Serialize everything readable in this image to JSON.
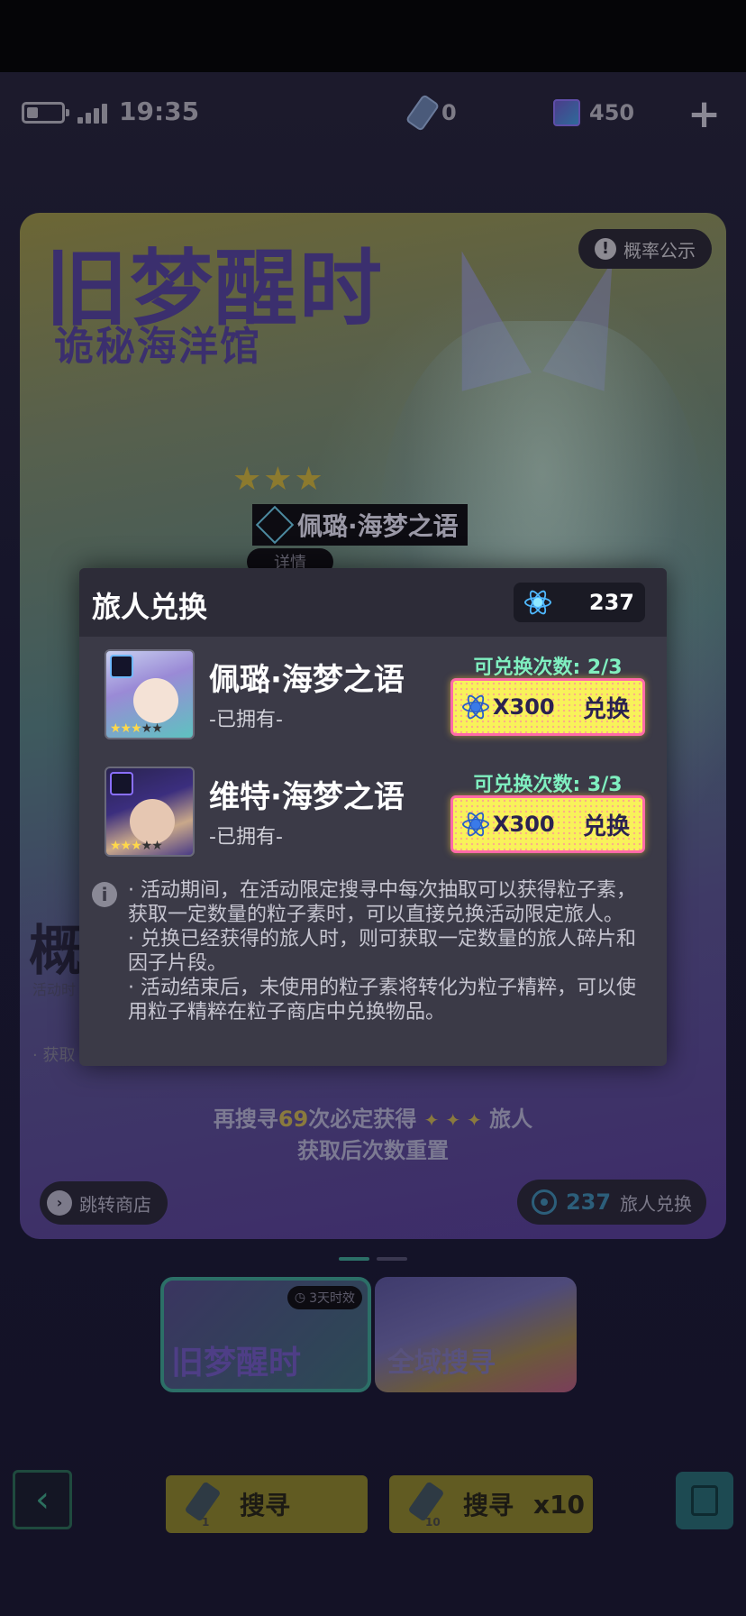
{
  "status_bar": {
    "time": "19:35",
    "ticket_count": "0",
    "cube_count": "450",
    "plus_label": "+"
  },
  "banner": {
    "title": "旧梦醒时",
    "subtitle": "诡秘海洋馆",
    "probability_label": "概率公示",
    "stars": "★★★",
    "featured_name": "佩璐·海梦之语",
    "detail_label": "详情",
    "guarantee_line1_prefix": "再搜寻",
    "guarantee_number": "69",
    "guarantee_line1_mid": "次必定获得",
    "guarantee_stars": "✦ ✦ ✦",
    "guarantee_line1_suffix": "旅人",
    "guarantee_line2": "获取后次数重置",
    "shop_label": "跳转商店",
    "exchange_count": "237",
    "exchange_label": "旅人兑换",
    "left_big": "概",
    "left_small": "活动时",
    "left_dot": "· 获取"
  },
  "tabs": [
    {
      "name": "旧梦醒时",
      "timer": "3天时效"
    },
    {
      "name": "全域搜寻"
    }
  ],
  "bottom_bar": {
    "back_icon": "‹",
    "search_single_label": "搜寻",
    "search_single_count": "1",
    "search_multi_label": "搜寻",
    "search_multi_suffix": "x10",
    "search_multi_count": "10"
  },
  "modal": {
    "title": "旅人兑换",
    "balance": "237",
    "items": [
      {
        "name": "佩璐·海梦之语",
        "owned": "-已拥有-",
        "count_label": "可兑换次数:  2/3",
        "price": "X300",
        "button": "兑换"
      },
      {
        "name": "维特·海梦之语",
        "owned": "-已拥有-",
        "count_label": "可兑换次数:  3/3",
        "price": "X300",
        "button": "兑换"
      }
    ],
    "info_icon": "i",
    "notes": [
      "· 活动期间，在活动限定搜寻中每次抽取可以获得粒子素，获取一定数量的粒子素时，可以直接兑换活动限定旅人。",
      "· 兑换已经获得的旅人时，则可获取一定数量的旅人碎片和因子片段。",
      "· 活动结束后，未使用的粒子素将转化为粒子精粹，可以使用粒子精粹在粒子商店中兑换物品。"
    ]
  },
  "colors": {
    "accent_yellow": "#f8f25a",
    "accent_pink": "#ff6aa8",
    "count_green": "#7fefc0",
    "modal_bg": "#3b3a47"
  }
}
